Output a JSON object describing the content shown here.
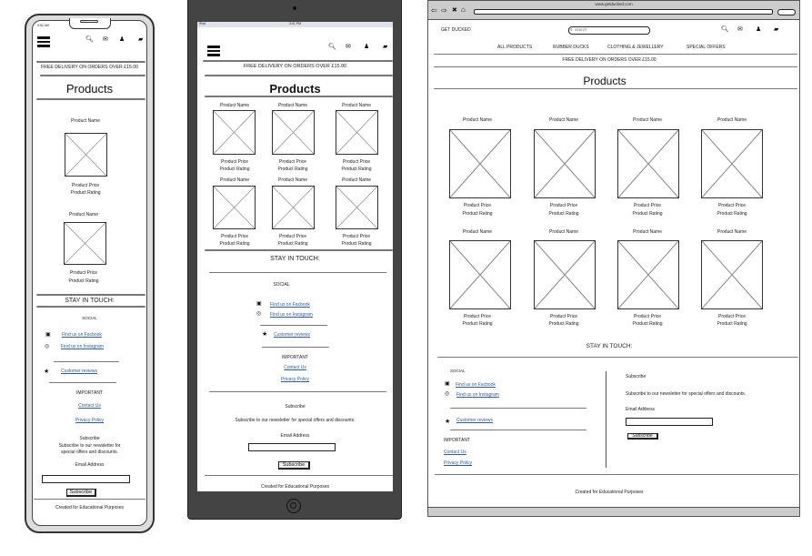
{
  "phone": {
    "status_time": "9:52 AM"
  },
  "tablet": {
    "status_left": "iPad",
    "status_time": "3:41 PM"
  },
  "browser": {
    "url": "www.getducked.com",
    "search_placeholder": "search"
  },
  "site": {
    "brand": "GET DUCKED",
    "nav": [
      "ALL PRODUCTS",
      "RUBBER DUCKS",
      "CLOTHING & JEWELLERY",
      "SPECIAL OFFERS"
    ],
    "delivery": "FREE DELIVERY ON ORDERS OVER £15.00",
    "page_title": "Products",
    "product": {
      "name": "Product Name",
      "price": "Product Price",
      "rating": "Product Rating"
    },
    "footer": {
      "stay_in_touch": "STAY IN TOUCH:",
      "social": "SOCIAL",
      "facebook": "Find us on Facbook",
      "instagram": "Find us on Instagram",
      "reviews": "Customer reviews",
      "important": "IMPORTANT",
      "contact": "Contact Us",
      "privacy": "Privacy Policy",
      "subscribe_heading": "Subscribe",
      "subscribe_text": "Subscribe to our newsletter for special offers and discounts.",
      "subscribe_text_line1": "Subscribe to our newsletter for",
      "subscribe_text_line2": "special offers and discounts.",
      "email_label": "Email Address",
      "subscribe_button": "Subscribe",
      "credit": "Created for Educational Purposes"
    }
  },
  "icons": [
    "menu-icon",
    "search-icon",
    "mail-icon",
    "user-icon",
    "bag-icon",
    "facebook-icon",
    "instagram-icon",
    "star-icon"
  ]
}
